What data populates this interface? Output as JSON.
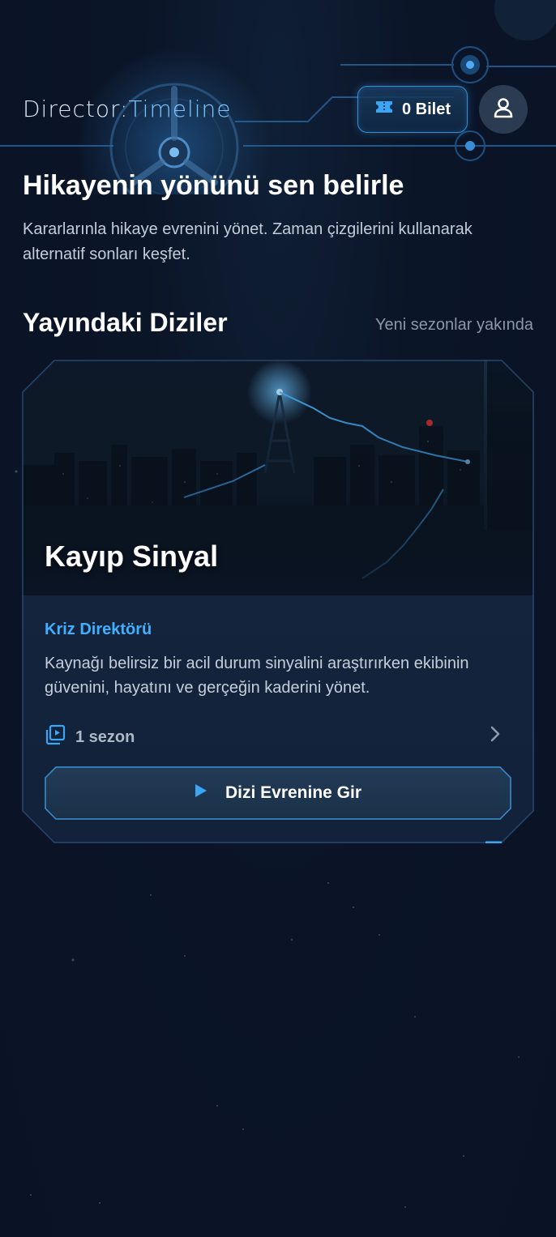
{
  "header": {
    "logo_main": "Director:",
    "logo_accent": "Timeline",
    "ticket_label": "0 Bilet"
  },
  "hero": {
    "title": "Hikayenin yönünü sen belirle",
    "subtitle": "Kararlarınla hikaye evrenini yönet. Zaman çizgilerini kullanarak alternatif sonları keşfet."
  },
  "section": {
    "title": "Yayındaki Diziler",
    "note": "Yeni sezonlar yakında"
  },
  "series": [
    {
      "title": "Kayıp Sinyal",
      "genre": "Kriz Direktörü",
      "description": "Kaynağı belirsiz bir acil durum sinyalini araştırırken ekibinin güvenini, hayatını ve gerçeğin kaderini yönet.",
      "seasons": "1 sezon",
      "cta": "Dizi Evrenine Gir"
    }
  ],
  "colors": {
    "accent": "#3fb0ff",
    "background": "#0b1528"
  }
}
